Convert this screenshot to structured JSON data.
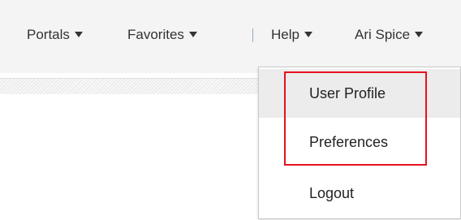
{
  "nav": {
    "portals_label": "Portals",
    "favorites_label": "Favorites",
    "help_label": "Help",
    "user_label": "Ari Spice"
  },
  "user_menu": {
    "items": [
      {
        "label": "User Profile"
      },
      {
        "label": "Preferences"
      },
      {
        "label": "Logout"
      }
    ]
  },
  "colors": {
    "highlight_border": "#e8101e",
    "topbar_bg": "#f4f4f4",
    "hover_bg": "#ececec"
  }
}
